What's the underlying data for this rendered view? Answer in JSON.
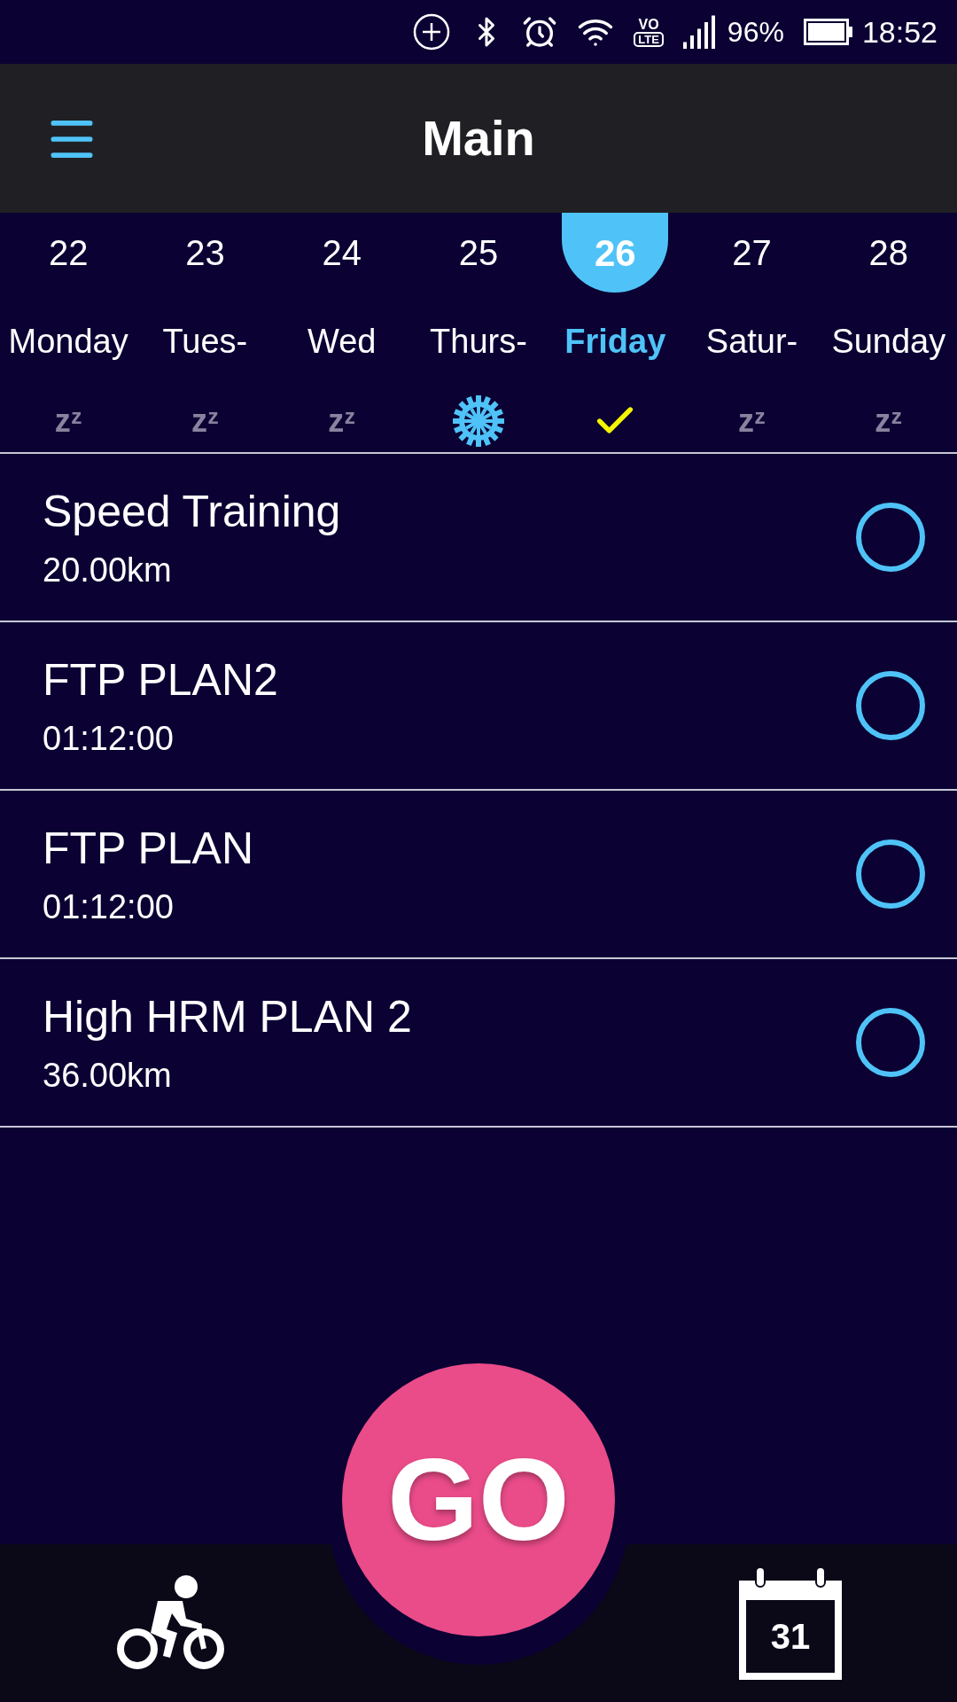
{
  "status_bar": {
    "volte_top": "VO",
    "volte_bottom": "LTE",
    "battery": "96%",
    "time": "18:52"
  },
  "header": {
    "title": "Main"
  },
  "week": [
    {
      "date": "22",
      "name": "Monday",
      "selected": false,
      "kind": "rest",
      "symbol": "zᶻ"
    },
    {
      "date": "23",
      "name": "Tues-",
      "selected": false,
      "kind": "rest",
      "symbol": "zᶻ"
    },
    {
      "date": "24",
      "name": "Wed",
      "selected": false,
      "kind": "rest",
      "symbol": "zᶻ"
    },
    {
      "date": "25",
      "name": "Thurs-",
      "selected": false,
      "kind": "workout"
    },
    {
      "date": "26",
      "name": "Friday",
      "selected": true,
      "kind": "done"
    },
    {
      "date": "27",
      "name": "Satur-",
      "selected": false,
      "kind": "rest",
      "symbol": "zᶻ"
    },
    {
      "date": "28",
      "name": "Sunday",
      "selected": false,
      "kind": "rest",
      "symbol": "zᶻ"
    }
  ],
  "workouts": [
    {
      "title": "Speed Training",
      "detail": "20.00km",
      "completed": false
    },
    {
      "title": "FTP PLAN2",
      "detail": "01:12:00",
      "completed": false
    },
    {
      "title": "FTP PLAN",
      "detail": "01:12:00",
      "completed": false
    },
    {
      "title": "High HRM PLAN 2",
      "detail": "36.00km",
      "completed": false
    }
  ],
  "go_button": {
    "label": "GO"
  },
  "bottom_nav": {
    "calendar_day": "31"
  }
}
